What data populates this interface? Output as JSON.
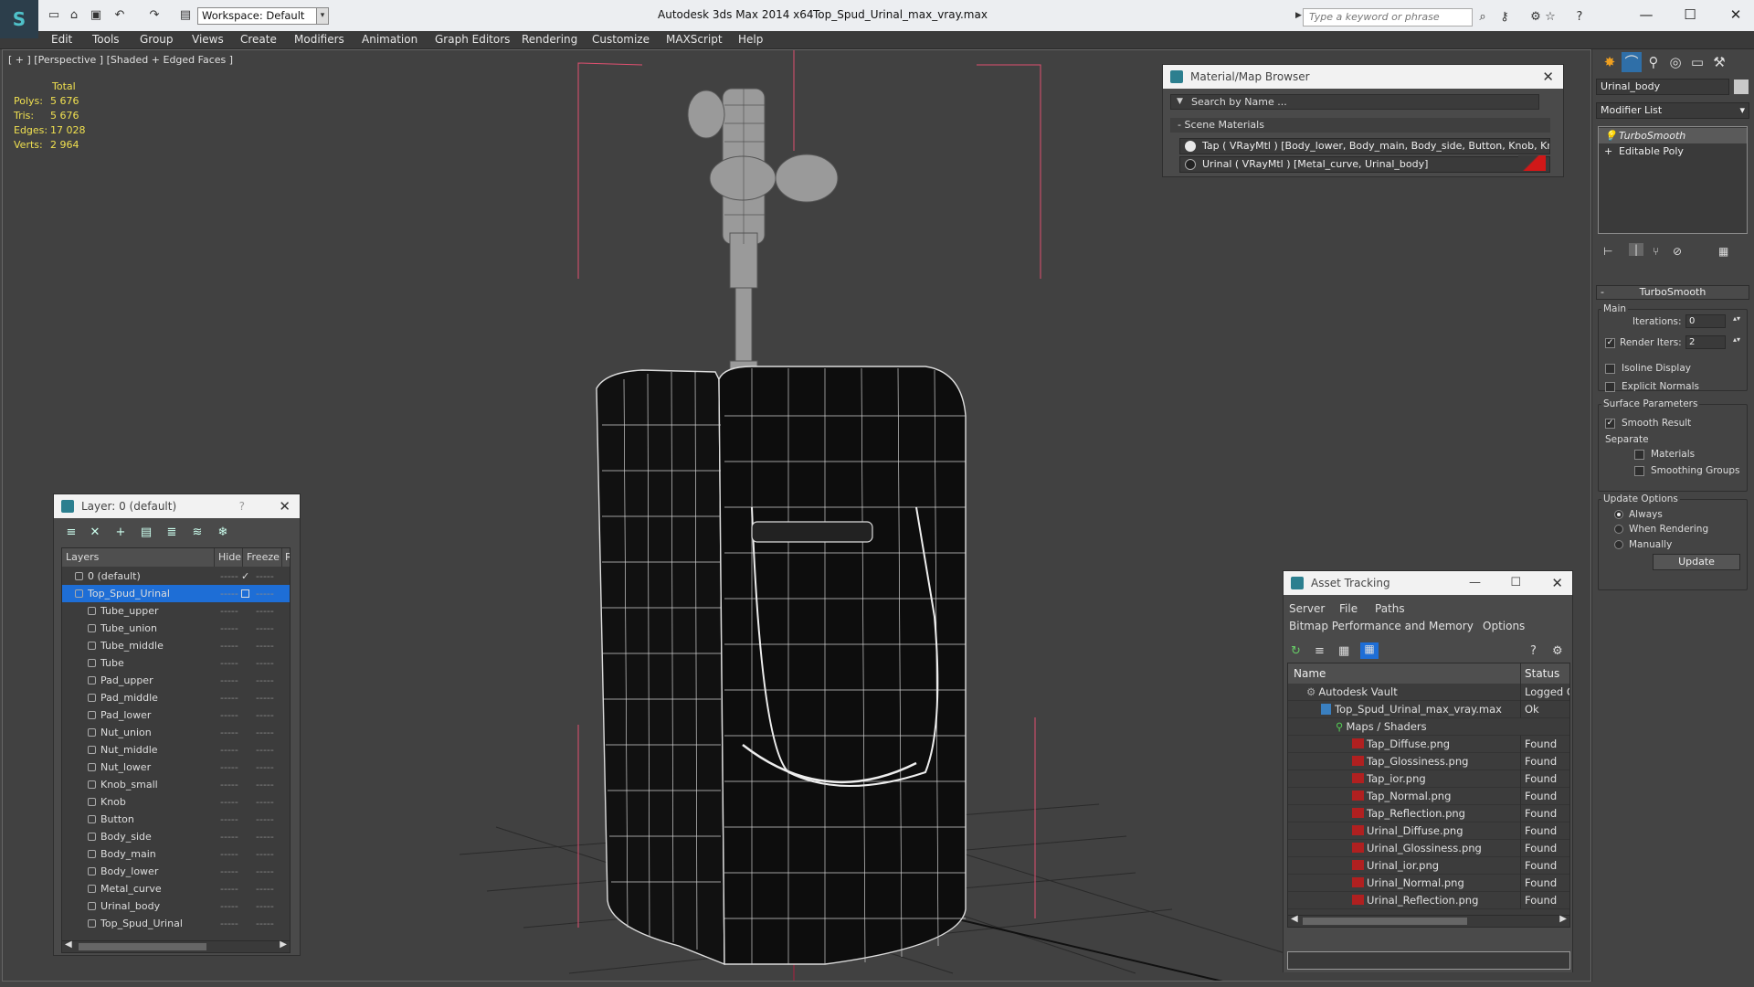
{
  "titlebar": {
    "workspace": "Workspace: Default",
    "app_title": "Autodesk 3ds Max  2014 x64",
    "file_title": "Top_Spud_Urinal_max_vray.max",
    "search_placeholder": "Type a keyword or phrase"
  },
  "menu": [
    "Edit",
    "Tools",
    "Group",
    "Views",
    "Create",
    "Modifiers",
    "Animation",
    "Graph Editors",
    "Rendering",
    "Customize",
    "MAXScript",
    "Help"
  ],
  "viewport": {
    "label": "[ + ] [Perspective ] [Shaded + Edged Faces ]",
    "stats": {
      "total_label": "Total",
      "polys_label": "Polys:",
      "polys": "5 676",
      "tris_label": "Tris:",
      "tris": "5 676",
      "edges_label": "Edges:",
      "edges": "17 028",
      "verts_label": "Verts:",
      "verts": "2 964"
    }
  },
  "material_browser": {
    "title": "Material/Map Browser",
    "search_placeholder": "Search by Name ...",
    "section": "Scene Materials",
    "items": [
      "Tap  ( VRayMtl ) [Body_lower, Body_main, Body_side, Button, Knob, Kno...",
      "Urinal  ( VRayMtl ) [Metal_curve, Urinal_body]"
    ]
  },
  "layer_dialog": {
    "title": "Layer: 0 (default)",
    "help": "?",
    "col_layers": "Layers",
    "col_hide": "Hide",
    "col_freeze": "Freeze",
    "col_r": "R",
    "rows": [
      "0 (default)",
      "Top_Spud_Urinal",
      "Tube_upper",
      "Tube_union",
      "Tube_middle",
      "Tube",
      "Pad_upper",
      "Pad_middle",
      "Pad_lower",
      "Nut_union",
      "Nut_middle",
      "Nut_lower",
      "Knob_small",
      "Knob",
      "Button",
      "Body_side",
      "Body_main",
      "Body_lower",
      "Metal_curve",
      "Urinal_body",
      "Top_Spud_Urinal"
    ],
    "dash": "-----"
  },
  "asset_tracking": {
    "title": "Asset Tracking",
    "menu1": [
      "Server",
      "File",
      "Paths"
    ],
    "menu2": [
      "Bitmap Performance and Memory",
      "Options"
    ],
    "col_name": "Name",
    "col_status": "Status",
    "rows": [
      {
        "name": "Autodesk Vault",
        "status": "Logged O"
      },
      {
        "name": "Top_Spud_Urinal_max_vray.max",
        "status": "Ok"
      },
      {
        "name": "Maps / Shaders",
        "status": ""
      },
      {
        "name": "Tap_Diffuse.png",
        "status": "Found"
      },
      {
        "name": "Tap_Glossiness.png",
        "status": "Found"
      },
      {
        "name": "Tap_ior.png",
        "status": "Found"
      },
      {
        "name": "Tap_Normal.png",
        "status": "Found"
      },
      {
        "name": "Tap_Reflection.png",
        "status": "Found"
      },
      {
        "name": "Urinal_Diffuse.png",
        "status": "Found"
      },
      {
        "name": "Urinal_Glossiness.png",
        "status": "Found"
      },
      {
        "name": "Urinal_ior.png",
        "status": "Found"
      },
      {
        "name": "Urinal_Normal.png",
        "status": "Found"
      },
      {
        "name": "Urinal_Reflection.png",
        "status": "Found"
      }
    ]
  },
  "command_panel": {
    "object_name": "Urinal_body",
    "modifier_list": "Modifier List",
    "stack": [
      "TurboSmooth",
      "Editable Poly"
    ],
    "rollout": "TurboSmooth",
    "main": "Main",
    "iterations_label": "Iterations:",
    "iterations": "0",
    "render_iters_label": "Render Iters:",
    "render_iters": "2",
    "isoline": "Isoline Display",
    "explicit": "Explicit Normals",
    "surface": "Surface Parameters",
    "smooth_result": "Smooth Result",
    "separate": "Separate",
    "materials": "Materials",
    "smoothing_groups": "Smoothing Groups",
    "update_options": "Update Options",
    "always": "Always",
    "when_rendering": "When Rendering",
    "manually": "Manually",
    "update_button": "Update"
  },
  "colors": {
    "selection": "#1e6ed6",
    "viewport_bg": "#414141",
    "stats_text": "#f0e050",
    "bbox": "#e05070"
  }
}
